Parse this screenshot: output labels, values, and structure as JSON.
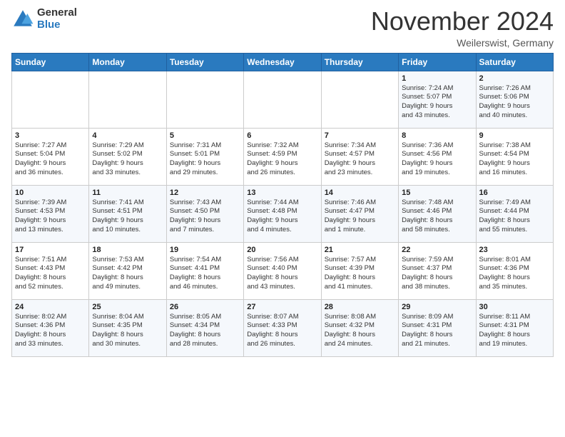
{
  "logo": {
    "general": "General",
    "blue": "Blue"
  },
  "header": {
    "month": "November 2024",
    "location": "Weilerswist, Germany"
  },
  "days_of_week": [
    "Sunday",
    "Monday",
    "Tuesday",
    "Wednesday",
    "Thursday",
    "Friday",
    "Saturday"
  ],
  "weeks": [
    [
      {
        "day": "",
        "info": ""
      },
      {
        "day": "",
        "info": ""
      },
      {
        "day": "",
        "info": ""
      },
      {
        "day": "",
        "info": ""
      },
      {
        "day": "",
        "info": ""
      },
      {
        "day": "1",
        "info": "Sunrise: 7:24 AM\nSunset: 5:07 PM\nDaylight: 9 hours\nand 43 minutes."
      },
      {
        "day": "2",
        "info": "Sunrise: 7:26 AM\nSunset: 5:06 PM\nDaylight: 9 hours\nand 40 minutes."
      }
    ],
    [
      {
        "day": "3",
        "info": "Sunrise: 7:27 AM\nSunset: 5:04 PM\nDaylight: 9 hours\nand 36 minutes."
      },
      {
        "day": "4",
        "info": "Sunrise: 7:29 AM\nSunset: 5:02 PM\nDaylight: 9 hours\nand 33 minutes."
      },
      {
        "day": "5",
        "info": "Sunrise: 7:31 AM\nSunset: 5:01 PM\nDaylight: 9 hours\nand 29 minutes."
      },
      {
        "day": "6",
        "info": "Sunrise: 7:32 AM\nSunset: 4:59 PM\nDaylight: 9 hours\nand 26 minutes."
      },
      {
        "day": "7",
        "info": "Sunrise: 7:34 AM\nSunset: 4:57 PM\nDaylight: 9 hours\nand 23 minutes."
      },
      {
        "day": "8",
        "info": "Sunrise: 7:36 AM\nSunset: 4:56 PM\nDaylight: 9 hours\nand 19 minutes."
      },
      {
        "day": "9",
        "info": "Sunrise: 7:38 AM\nSunset: 4:54 PM\nDaylight: 9 hours\nand 16 minutes."
      }
    ],
    [
      {
        "day": "10",
        "info": "Sunrise: 7:39 AM\nSunset: 4:53 PM\nDaylight: 9 hours\nand 13 minutes."
      },
      {
        "day": "11",
        "info": "Sunrise: 7:41 AM\nSunset: 4:51 PM\nDaylight: 9 hours\nand 10 minutes."
      },
      {
        "day": "12",
        "info": "Sunrise: 7:43 AM\nSunset: 4:50 PM\nDaylight: 9 hours\nand 7 minutes."
      },
      {
        "day": "13",
        "info": "Sunrise: 7:44 AM\nSunset: 4:48 PM\nDaylight: 9 hours\nand 4 minutes."
      },
      {
        "day": "14",
        "info": "Sunrise: 7:46 AM\nSunset: 4:47 PM\nDaylight: 9 hours\nand 1 minute."
      },
      {
        "day": "15",
        "info": "Sunrise: 7:48 AM\nSunset: 4:46 PM\nDaylight: 8 hours\nand 58 minutes."
      },
      {
        "day": "16",
        "info": "Sunrise: 7:49 AM\nSunset: 4:44 PM\nDaylight: 8 hours\nand 55 minutes."
      }
    ],
    [
      {
        "day": "17",
        "info": "Sunrise: 7:51 AM\nSunset: 4:43 PM\nDaylight: 8 hours\nand 52 minutes."
      },
      {
        "day": "18",
        "info": "Sunrise: 7:53 AM\nSunset: 4:42 PM\nDaylight: 8 hours\nand 49 minutes."
      },
      {
        "day": "19",
        "info": "Sunrise: 7:54 AM\nSunset: 4:41 PM\nDaylight: 8 hours\nand 46 minutes."
      },
      {
        "day": "20",
        "info": "Sunrise: 7:56 AM\nSunset: 4:40 PM\nDaylight: 8 hours\nand 43 minutes."
      },
      {
        "day": "21",
        "info": "Sunrise: 7:57 AM\nSunset: 4:39 PM\nDaylight: 8 hours\nand 41 minutes."
      },
      {
        "day": "22",
        "info": "Sunrise: 7:59 AM\nSunset: 4:37 PM\nDaylight: 8 hours\nand 38 minutes."
      },
      {
        "day": "23",
        "info": "Sunrise: 8:01 AM\nSunset: 4:36 PM\nDaylight: 8 hours\nand 35 minutes."
      }
    ],
    [
      {
        "day": "24",
        "info": "Sunrise: 8:02 AM\nSunset: 4:36 PM\nDaylight: 8 hours\nand 33 minutes."
      },
      {
        "day": "25",
        "info": "Sunrise: 8:04 AM\nSunset: 4:35 PM\nDaylight: 8 hours\nand 30 minutes."
      },
      {
        "day": "26",
        "info": "Sunrise: 8:05 AM\nSunset: 4:34 PM\nDaylight: 8 hours\nand 28 minutes."
      },
      {
        "day": "27",
        "info": "Sunrise: 8:07 AM\nSunset: 4:33 PM\nDaylight: 8 hours\nand 26 minutes."
      },
      {
        "day": "28",
        "info": "Sunrise: 8:08 AM\nSunset: 4:32 PM\nDaylight: 8 hours\nand 24 minutes."
      },
      {
        "day": "29",
        "info": "Sunrise: 8:09 AM\nSunset: 4:31 PM\nDaylight: 8 hours\nand 21 minutes."
      },
      {
        "day": "30",
        "info": "Sunrise: 8:11 AM\nSunset: 4:31 PM\nDaylight: 8 hours\nand 19 minutes."
      }
    ]
  ]
}
